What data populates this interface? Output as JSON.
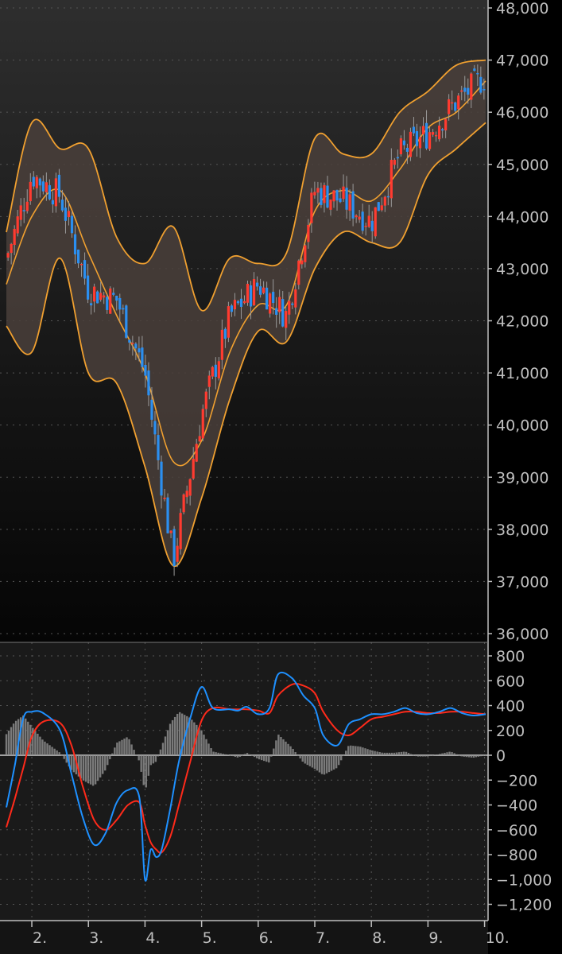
{
  "colors": {
    "up": "#ff3b30",
    "down": "#2b8ff0",
    "band_line": "#f0a030",
    "band_fill": "#4a3f3b",
    "macd_line": "#1e90ff",
    "signal_line": "#ff2a1a",
    "histogram": "#8c8c8c",
    "axis": "#bfbfbf",
    "grid": "#555555"
  },
  "chart_data": [
    {
      "type": "candlestick",
      "title": "",
      "ylim": [
        36000,
        48000
      ],
      "y_ticks": [
        "48,000",
        "47,000",
        "46,000",
        "45,000",
        "44,000",
        "43,000",
        "42,000",
        "41,000",
        "40,000",
        "39,000",
        "38,000",
        "37,000",
        "36,000"
      ],
      "y_tick_values": [
        48000,
        47000,
        46000,
        45000,
        44000,
        43000,
        42000,
        41000,
        40000,
        39000,
        38000,
        37000,
        36000
      ],
      "grid": "dotted horizontal",
      "overlay": "Bollinger bands",
      "x_months": [
        1.55,
        2,
        2.5,
        3,
        3.5,
        4,
        4.5,
        5,
        5.5,
        6,
        6.5,
        7,
        7.5,
        8,
        8.5,
        9,
        9.5,
        10.02
      ],
      "close": [
        43200,
        44800,
        44400,
        42600,
        42400,
        41000,
        37400,
        40200,
        42100,
        42700,
        42100,
        44500,
        44300,
        43900,
        45200,
        45600,
        46200,
        46700
      ],
      "upper": [
        43700,
        45800,
        45300,
        45300,
        43600,
        43100,
        43800,
        42200,
        43200,
        43100,
        43300,
        45500,
        45200,
        45200,
        46000,
        46400,
        46900,
        47000
      ],
      "middle": [
        42700,
        44000,
        44500,
        43300,
        42100,
        41000,
        39300,
        39700,
        41400,
        42300,
        42300,
        44100,
        44500,
        44300,
        44900,
        45700,
        46000,
        46600
      ],
      "lower": [
        41900,
        41400,
        43200,
        41000,
        40800,
        39200,
        37300,
        38600,
        40500,
        41800,
        41600,
        43000,
        43700,
        43500,
        43500,
        44800,
        45300,
        45800
      ]
    },
    {
      "type": "macd",
      "title": "",
      "ylim": [
        -1300,
        850
      ],
      "y_ticks": [
        "800",
        "600",
        "400",
        "200",
        "0",
        "−200",
        "−400",
        "−600",
        "−800",
        "−1,000",
        "−1,200"
      ],
      "y_tick_values": [
        800,
        600,
        400,
        200,
        0,
        -200,
        -400,
        -600,
        -800,
        -1000,
        -1200
      ],
      "x_ticks": [
        "2.",
        "3.",
        "4.",
        "5.",
        "6.",
        "7.",
        "8.",
        "9.",
        "10."
      ],
      "x_tick_values": [
        2,
        3,
        4,
        5,
        6,
        7,
        8,
        9,
        10
      ],
      "x": [
        1.55,
        1.7,
        1.85,
        2.0,
        2.2,
        2.5,
        2.7,
        2.9,
        3.1,
        3.3,
        3.5,
        3.7,
        3.9,
        4.0,
        4.1,
        4.2,
        4.3,
        4.45,
        4.6,
        4.8,
        5.0,
        5.2,
        5.5,
        5.65,
        5.8,
        6.0,
        6.2,
        6.35,
        6.6,
        6.8,
        7.0,
        7.15,
        7.4,
        7.6,
        7.8,
        8.0,
        8.2,
        8.4,
        8.6,
        8.8,
        9.0,
        9.2,
        9.4,
        9.6,
        9.8,
        10.02
      ],
      "macd": [
        -420,
        -80,
        300,
        350,
        340,
        200,
        -150,
        -500,
        -720,
        -630,
        -380,
        -280,
        -340,
        -1000,
        -760,
        -820,
        -750,
        -420,
        -50,
        300,
        550,
        380,
        370,
        360,
        390,
        330,
        380,
        650,
        620,
        480,
        380,
        160,
        80,
        250,
        290,
        330,
        330,
        350,
        380,
        340,
        330,
        350,
        380,
        340,
        320,
        330
      ],
      "signal": [
        -580,
        -350,
        -100,
        150,
        270,
        260,
        80,
        -250,
        -520,
        -600,
        -520,
        -400,
        -380,
        -560,
        -700,
        -760,
        -780,
        -650,
        -400,
        -50,
        280,
        380,
        370,
        370,
        370,
        360,
        340,
        480,
        570,
        560,
        500,
        350,
        200,
        160,
        220,
        290,
        310,
        330,
        350,
        350,
        340,
        340,
        350,
        350,
        340,
        330
      ],
      "histogram": [
        170,
        270,
        320,
        230,
        120,
        20,
        -120,
        -200,
        -250,
        -120,
        100,
        150,
        -50,
        -300,
        -80,
        -50,
        80,
        260,
        350,
        300,
        200,
        30,
        0,
        -20,
        20,
        -30,
        -60,
        170,
        60,
        -60,
        -110,
        -160,
        -100,
        80,
        70,
        40,
        20,
        20,
        30,
        -10,
        -10,
        10,
        30,
        -10,
        -20,
        0
      ]
    }
  ]
}
